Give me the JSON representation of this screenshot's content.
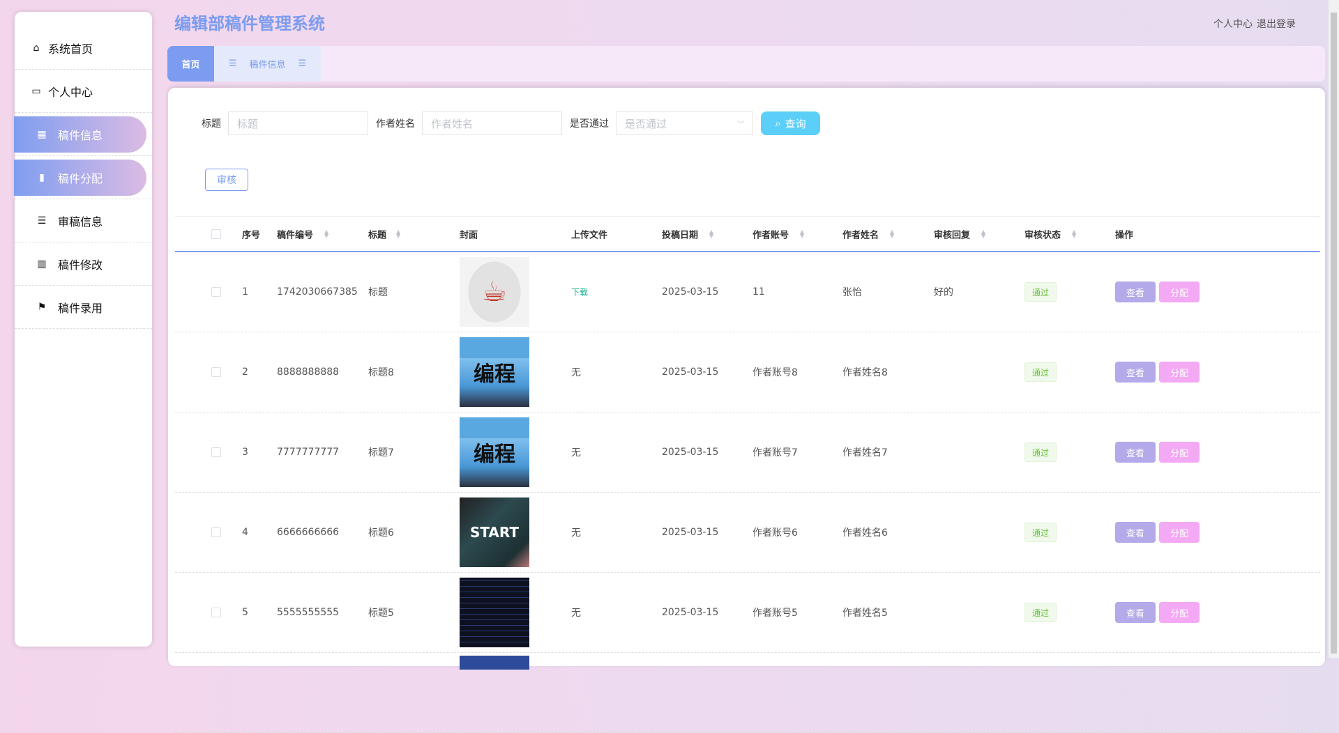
{
  "header": {
    "title": "编辑部稿件管理系统",
    "profile": "个人中心",
    "logout": "退出登录"
  },
  "sidebar": {
    "items": [
      {
        "label": "系统首页",
        "icon": "home-icon",
        "active": false
      },
      {
        "label": "个人中心",
        "icon": "user-card-icon",
        "active": false
      },
      {
        "label": "稿件信息",
        "icon": "grid-icon",
        "active": true
      },
      {
        "label": "稿件分配",
        "icon": "clipboard-icon",
        "active": true
      },
      {
        "label": "审稿信息",
        "icon": "list-icon",
        "active": false
      },
      {
        "label": "稿件修改",
        "icon": "books-icon",
        "active": false
      },
      {
        "label": "稿件录用",
        "icon": "flag-icon",
        "active": false
      }
    ]
  },
  "tabs": {
    "home": "首页",
    "current": "稿件信息"
  },
  "search": {
    "title_label": "标题",
    "title_placeholder": "标题",
    "author_label": "作者姓名",
    "author_placeholder": "作者姓名",
    "pass_label": "是否通过",
    "pass_placeholder": "是否通过",
    "query": "查询"
  },
  "actions": {
    "audit": "审核"
  },
  "table": {
    "headers": [
      "序号",
      "稿件编号",
      "标题",
      "封面",
      "上传文件",
      "投稿日期",
      "作者账号",
      "作者姓名",
      "审核回复",
      "审核状态",
      "操作"
    ],
    "view": "查看",
    "assign": "分配",
    "rows": [
      {
        "idx": "1",
        "no": "1742030667385",
        "title": "标题",
        "cover": "java",
        "file": "下载",
        "date": "2025-03-15",
        "account": "11",
        "name": "张怡",
        "reply": "好的",
        "status": "通过"
      },
      {
        "idx": "2",
        "no": "8888888888",
        "title": "标题8",
        "cover": "poster",
        "file": "无",
        "date": "2025-03-15",
        "account": "作者账号8",
        "name": "作者姓名8",
        "reply": "",
        "status": "通过"
      },
      {
        "idx": "3",
        "no": "7777777777",
        "title": "标题7",
        "cover": "poster",
        "file": "无",
        "date": "2025-03-15",
        "account": "作者账号7",
        "name": "作者姓名7",
        "reply": "",
        "status": "通过"
      },
      {
        "idx": "4",
        "no": "6666666666",
        "title": "标题6",
        "cover": "start",
        "file": "无",
        "date": "2025-03-15",
        "account": "作者账号6",
        "name": "作者姓名6",
        "reply": "",
        "status": "通过"
      },
      {
        "idx": "5",
        "no": "5555555555",
        "title": "标题5",
        "cover": "code",
        "file": "无",
        "date": "2025-03-15",
        "account": "作者账号5",
        "name": "作者姓名5",
        "reply": "",
        "status": "通过"
      }
    ]
  },
  "colors": {
    "accent": "#7b9cf0",
    "query": "#5ccff8",
    "view": "#b4a9e9",
    "assign": "#f3a9f3",
    "download": "#1ab394"
  }
}
